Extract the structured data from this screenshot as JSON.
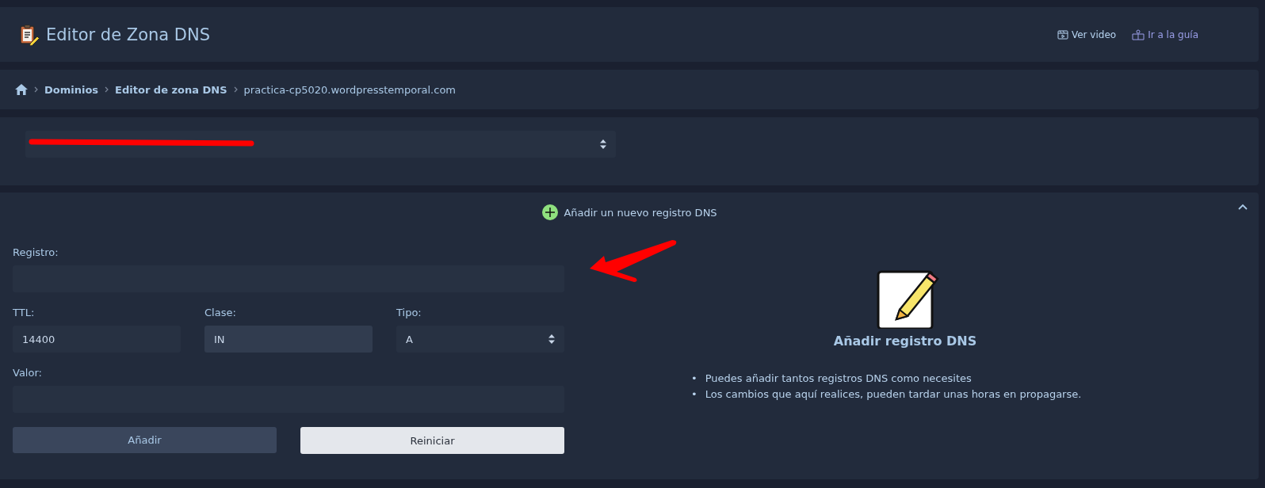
{
  "header": {
    "title": "Editor de Zona DNS",
    "links": [
      {
        "label": "Ver video",
        "kind": "video"
      },
      {
        "label": "Ir a la guía",
        "kind": "guide"
      }
    ]
  },
  "breadcrumb": [
    {
      "label": "Dominios",
      "kind": "link"
    },
    {
      "label": "Editor de zona DNS",
      "kind": "link"
    },
    {
      "label": "practica-cp5020.wordpresstemporal.com",
      "kind": "current"
    }
  ],
  "domain_select": {
    "redacted": true
  },
  "panel": {
    "title": "Añadir un nuevo registro DNS",
    "expanded": true,
    "fields": [
      {
        "label": "Registro:",
        "kind": "text"
      },
      {
        "label": "TTL:",
        "value": "14400",
        "kind": "text"
      },
      {
        "label": "Clase:",
        "value": "IN",
        "kind": "readonly"
      },
      {
        "label": "Tipo:",
        "value": "A",
        "kind": "select"
      },
      {
        "label": "Valor:",
        "kind": "text"
      }
    ],
    "buttons": [
      {
        "label": "Añadir",
        "kind": "primary"
      },
      {
        "label": "Reiniciar",
        "kind": "secondary"
      }
    ],
    "info": {
      "title": "Añadir registro DNS",
      "bullets": [
        {
          "marker": "•",
          "text": "Puedes añadir tantos registros DNS como necesites"
        },
        {
          "marker": "•",
          "text": "Los cambios que aquí realices, pueden tardar unas horas en propagarse."
        }
      ]
    }
  }
}
